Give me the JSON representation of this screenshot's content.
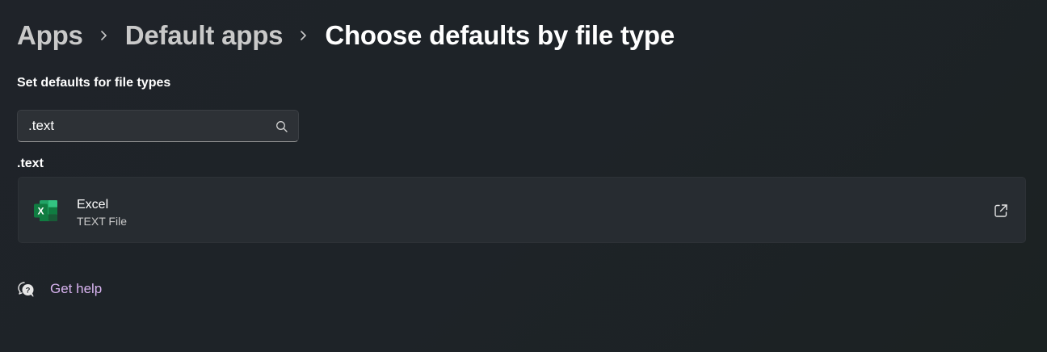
{
  "breadcrumb": {
    "items": [
      "Apps",
      "Default apps"
    ],
    "current": "Choose defaults by file type"
  },
  "section": {
    "title": "Set defaults for file types"
  },
  "search": {
    "value": ".text",
    "icon": "search-icon"
  },
  "results": {
    "group_label": ".text",
    "items": [
      {
        "app_name": "Excel",
        "subtitle": "TEXT File",
        "icon": "excel-icon",
        "action_icon": "external-link-icon"
      }
    ]
  },
  "help": {
    "label": "Get help",
    "icon": "help-chat-icon"
  },
  "colors": {
    "background": "#1f2329",
    "card": "#272c31",
    "link": "#d7b3ef",
    "excel_green": "#107c41"
  }
}
